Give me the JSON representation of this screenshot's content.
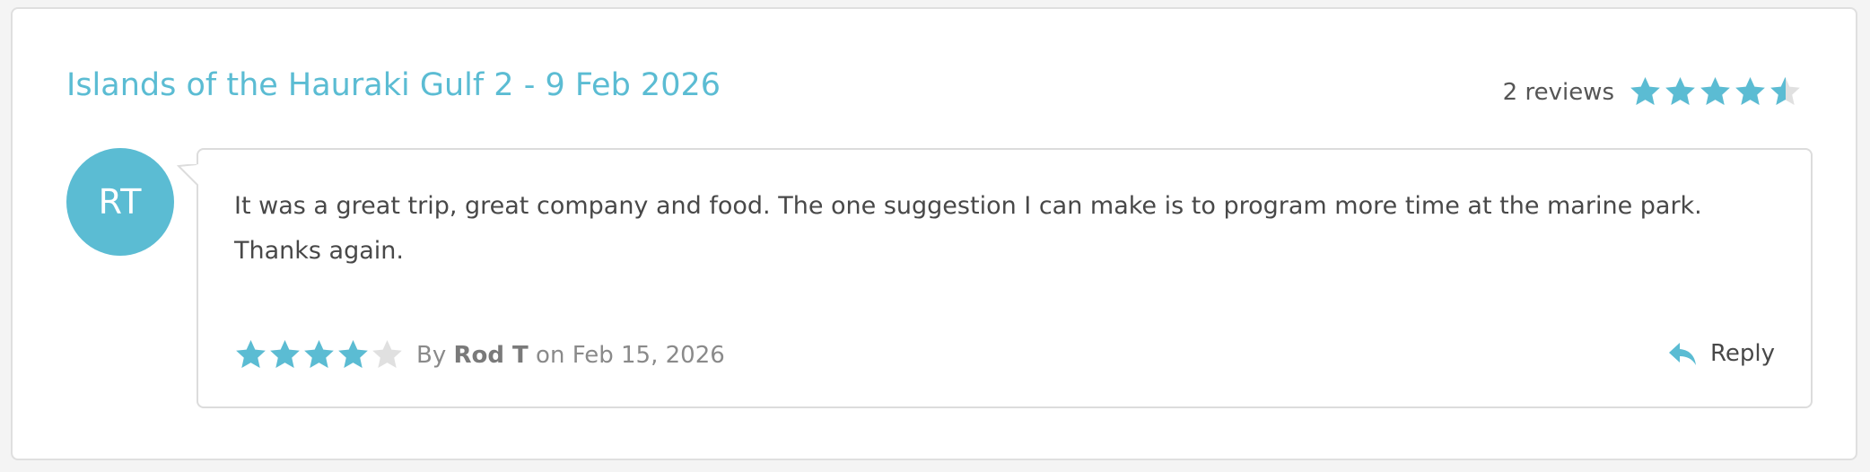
{
  "trip": {
    "title": "Islands of the Hauraki Gulf 2 - 9 Feb 2026",
    "review_count_label": "2 reviews",
    "average_rating": 4.5,
    "max_rating": 5
  },
  "review": {
    "avatar_initials": "RT",
    "text": "It was a great trip, great company and food. The one suggestion I can make is to program more time at the marine park. Thanks again.",
    "rating": 4,
    "max_rating": 5,
    "by_label": "By",
    "author": "Rod T",
    "on_label": "on",
    "date": "Feb 15, 2026",
    "reply_label": "Reply"
  },
  "colors": {
    "accent": "#5bbcd3",
    "star_empty": "#e0e0e0",
    "text": "#484848",
    "muted": "#8a8a8a",
    "border": "#dcdcdc"
  },
  "icons": {
    "star": "star-icon",
    "reply": "reply-icon"
  }
}
